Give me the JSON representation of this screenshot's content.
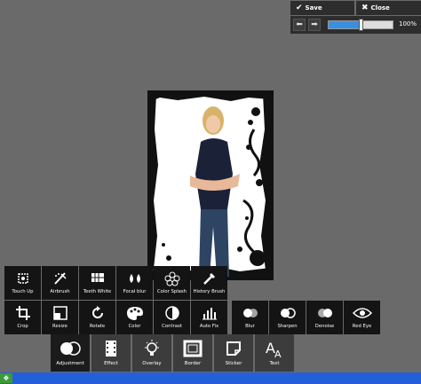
{
  "toolbar": {
    "save_label": "Save",
    "close_label": "Close",
    "zoom_label": "100%",
    "zoom_fraction": 0.5
  },
  "tools_row1": [
    {
      "label": "Touch Up",
      "icon": "touch-up-icon"
    },
    {
      "label": "Airbrush",
      "icon": "airbrush-icon"
    },
    {
      "label": "Teeth White",
      "icon": "teeth-white-icon"
    },
    {
      "label": "Focal blur",
      "icon": "focal-blur-icon"
    },
    {
      "label": "Color Splash",
      "icon": "color-splash-icon"
    },
    {
      "label": "History Brush",
      "icon": "history-brush-icon"
    }
  ],
  "tools_row2": [
    {
      "label": "Crop",
      "icon": "crop-icon"
    },
    {
      "label": "Resize",
      "icon": "resize-icon"
    },
    {
      "label": "Rotate",
      "icon": "rotate-icon"
    },
    {
      "label": "Color",
      "icon": "palette-icon"
    },
    {
      "label": "Contrast",
      "icon": "contrast-icon"
    },
    {
      "label": "Auto Fix",
      "icon": "auto-fix-icon"
    },
    {
      "label": "Blur",
      "icon": "blur-icon"
    },
    {
      "label": "Sharpen",
      "icon": "sharpen-icon"
    },
    {
      "label": "Denoise",
      "icon": "denoise-icon"
    },
    {
      "label": "Red Eye",
      "icon": "red-eye-icon"
    }
  ],
  "categories": [
    {
      "label": "Adjustment",
      "icon": "adjustment-icon",
      "active": true
    },
    {
      "label": "Effect",
      "icon": "film-icon"
    },
    {
      "label": "Overlay",
      "icon": "lightbulb-icon"
    },
    {
      "label": "Border",
      "icon": "border-icon"
    },
    {
      "label": "Sticker",
      "icon": "sticker-icon"
    },
    {
      "label": "Text",
      "icon": "text-icon"
    }
  ],
  "colors": {
    "background": "#6a6a6a",
    "toolbar": "#2d2d2d",
    "tool_tile": "#141414",
    "category_tile": "#3c3c3c",
    "zoom_fill": "#3a8fde",
    "taskbar": "#245edb"
  }
}
